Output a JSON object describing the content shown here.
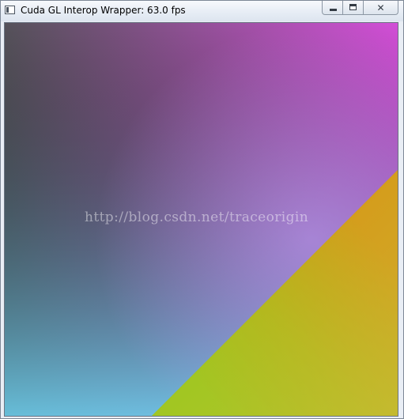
{
  "window": {
    "title": "Cuda GL Interop Wrapper: 63.0 fps",
    "app_icon": "window-app-icon",
    "buttons": {
      "minimize_icon": "minimize-icon",
      "maximize_icon": "maximize-icon",
      "close_icon": "close-icon"
    }
  },
  "render": {
    "description_colors": {
      "top_left": "#55525a",
      "top_right": "#d24fd7",
      "center_right": "#c988f5",
      "bottom_left": "#5bd0e6",
      "bottom_center": "#86c2f6",
      "diagonal_band_top": "#d8890a",
      "diagonal_band_bottom_left": "#8ac812",
      "diagonal_band_bottom_right": "#ccc23e"
    }
  },
  "watermark": {
    "text": "http://blog.csdn.net/traceorigin"
  }
}
